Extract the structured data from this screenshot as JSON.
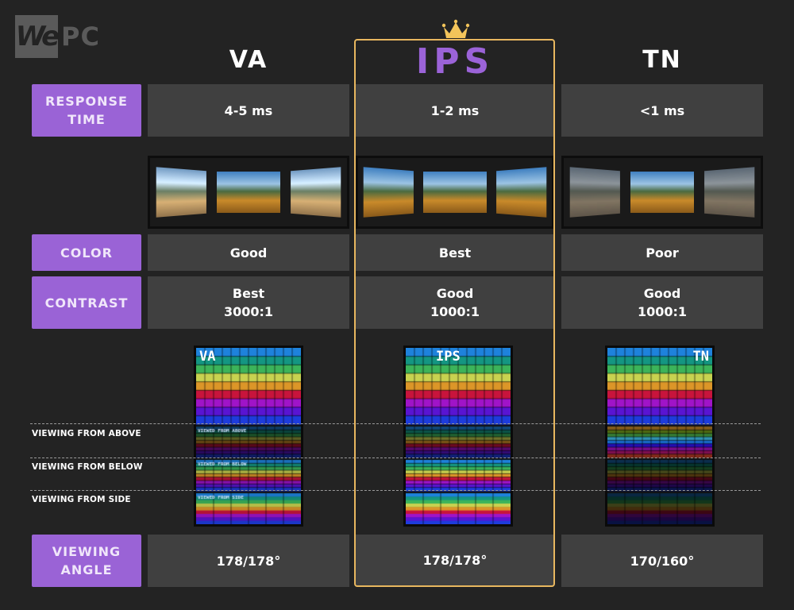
{
  "brand": {
    "logo_we": "We",
    "logo_pc": "PC"
  },
  "columns": [
    {
      "id": "va",
      "title": "VA",
      "panel_title": "VA",
      "response_time": "4-5 ms",
      "color": "Good",
      "contrast_rating": "Best",
      "contrast_ratio": "3000:1",
      "viewing_angle": "178/178°"
    },
    {
      "id": "ips",
      "title": "IPS",
      "panel_title": "IPS",
      "response_time": "1-2 ms",
      "color": "Best",
      "contrast_rating": "Good",
      "contrast_ratio": "1000:1",
      "viewing_angle": "178/178°",
      "highlighted": true,
      "badge": "crown-icon"
    },
    {
      "id": "tn",
      "title": "TN",
      "panel_title": "TN",
      "response_time": "<1 ms",
      "color": "Poor",
      "contrast_rating": "Good",
      "contrast_ratio": "1000:1",
      "viewing_angle": "170/160°"
    }
  ],
  "row_labels": {
    "response_time": [
      "RESPONSE",
      "TIME"
    ],
    "color": "COLOR",
    "contrast": "CONTRAST",
    "viewing_angle": [
      "VIEWING",
      "ANGLE"
    ]
  },
  "viewing_labels": [
    "VIEWING FROM ABOVE",
    "VIEWING FROM BELOW",
    "VIEWING FROM SIDE"
  ],
  "panel_captions": [
    "VIEWED FROM ABOVE",
    "VIEWED FROM BELOW",
    "VIEWED FROM SIDE"
  ],
  "colors": {
    "accent_purple": "#9a63d6",
    "highlight_gold": "#e8b75f",
    "cell_bg": "#404040",
    "page_bg": "#232323"
  }
}
